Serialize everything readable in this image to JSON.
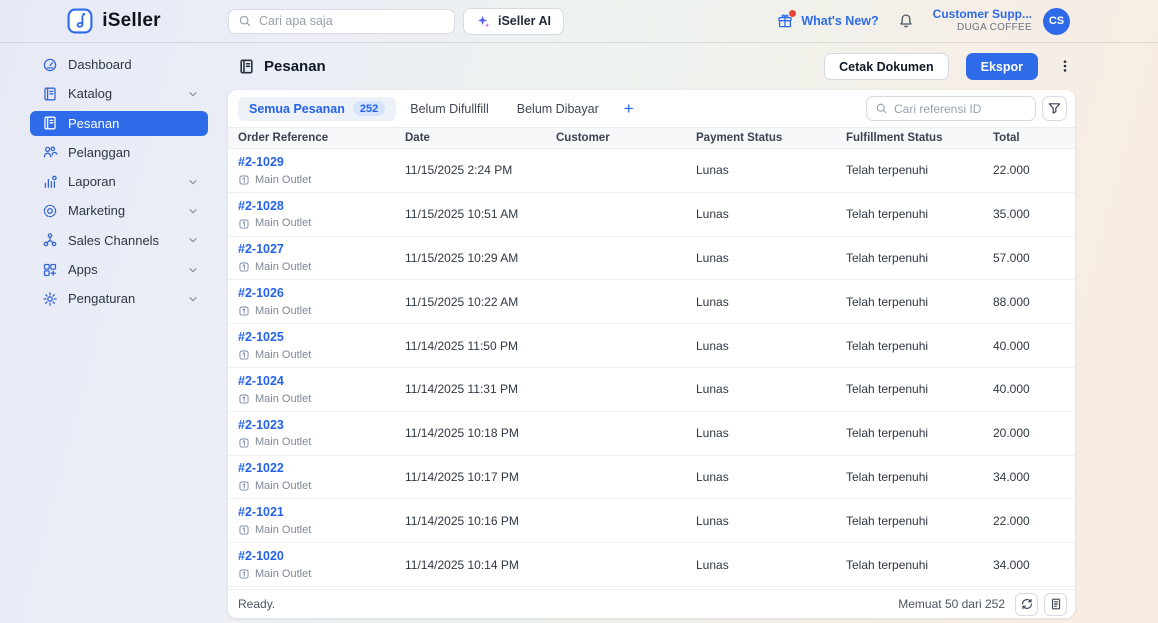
{
  "colors": {
    "primary": "#2e6be9",
    "link": "#2563eb"
  },
  "brand": {
    "name": "iSeller"
  },
  "topbar": {
    "search_placeholder": "Cari apa saja",
    "ai_button_label": "iSeller AI",
    "whats_new_label": "What's New?",
    "account_name": "Customer Supp...",
    "account_org": "DUGA COFFEE",
    "avatar_initials": "CS"
  },
  "sidebar": {
    "items": [
      {
        "label": "Dashboard",
        "icon": "dashboard-icon",
        "has_chevron": false,
        "active": false
      },
      {
        "label": "Katalog",
        "icon": "katalog-icon",
        "has_chevron": true,
        "active": false
      },
      {
        "label": "Pesanan",
        "icon": "pesanan-icon",
        "has_chevron": false,
        "active": true
      },
      {
        "label": "Pelanggan",
        "icon": "pelanggan-icon",
        "has_chevron": false,
        "active": false
      },
      {
        "label": "Laporan",
        "icon": "laporan-icon",
        "has_chevron": true,
        "active": false
      },
      {
        "label": "Marketing",
        "icon": "marketing-icon",
        "has_chevron": true,
        "active": false
      },
      {
        "label": "Sales Channels",
        "icon": "sales-channels-icon",
        "has_chevron": true,
        "active": false
      },
      {
        "label": "Apps",
        "icon": "apps-icon",
        "has_chevron": true,
        "active": false
      },
      {
        "label": "Pengaturan",
        "icon": "pengaturan-icon",
        "has_chevron": true,
        "active": false
      }
    ]
  },
  "page": {
    "title": "Pesanan",
    "print_button_label": "Cetak Dokumen",
    "export_button_label": "Ekspor",
    "tabs": [
      {
        "label": "Semua Pesanan",
        "badge": "252",
        "active": true
      },
      {
        "label": "Belum Difullfill",
        "active": false
      },
      {
        "label": "Belum Dibayar",
        "active": false
      }
    ],
    "add_tab_label": "+",
    "ref_search_placeholder": "Cari referensi ID"
  },
  "table": {
    "columns": [
      "Order Reference",
      "Date",
      "Customer",
      "Payment Status",
      "Fulfillment Status",
      "Total"
    ],
    "rows": [
      {
        "ref": "#2-1029",
        "outlet": "Main Outlet",
        "date": "11/15/2025 2:24 PM",
        "customer": "",
        "payment_status": "Lunas",
        "fulfillment_status": "Telah terpenuhi",
        "total": "22.000"
      },
      {
        "ref": "#2-1028",
        "outlet": "Main Outlet",
        "date": "11/15/2025 10:51 AM",
        "customer": "",
        "payment_status": "Lunas",
        "fulfillment_status": "Telah terpenuhi",
        "total": "35.000"
      },
      {
        "ref": "#2-1027",
        "outlet": "Main Outlet",
        "date": "11/15/2025 10:29 AM",
        "customer": "",
        "payment_status": "Lunas",
        "fulfillment_status": "Telah terpenuhi",
        "total": "57.000"
      },
      {
        "ref": "#2-1026",
        "outlet": "Main Outlet",
        "date": "11/15/2025 10:22 AM",
        "customer": "",
        "payment_status": "Lunas",
        "fulfillment_status": "Telah terpenuhi",
        "total": "88.000"
      },
      {
        "ref": "#2-1025",
        "outlet": "Main Outlet",
        "date": "11/14/2025 11:50 PM",
        "customer": "",
        "payment_status": "Lunas",
        "fulfillment_status": "Telah terpenuhi",
        "total": "40.000"
      },
      {
        "ref": "#2-1024",
        "outlet": "Main Outlet",
        "date": "11/14/2025 11:31 PM",
        "customer": "",
        "payment_status": "Lunas",
        "fulfillment_status": "Telah terpenuhi",
        "total": "40.000"
      },
      {
        "ref": "#2-1023",
        "outlet": "Main Outlet",
        "date": "11/14/2025 10:18 PM",
        "customer": "",
        "payment_status": "Lunas",
        "fulfillment_status": "Telah terpenuhi",
        "total": "20.000"
      },
      {
        "ref": "#2-1022",
        "outlet": "Main Outlet",
        "date": "11/14/2025 10:17 PM",
        "customer": "",
        "payment_status": "Lunas",
        "fulfillment_status": "Telah terpenuhi",
        "total": "34.000"
      },
      {
        "ref": "#2-1021",
        "outlet": "Main Outlet",
        "date": "11/14/2025 10:16 PM",
        "customer": "",
        "payment_status": "Lunas",
        "fulfillment_status": "Telah terpenuhi",
        "total": "22.000"
      },
      {
        "ref": "#2-1020",
        "outlet": "Main Outlet",
        "date": "11/14/2025 10:14 PM",
        "customer": "",
        "payment_status": "Lunas",
        "fulfillment_status": "Telah terpenuhi",
        "total": "34.000"
      }
    ]
  },
  "footer": {
    "status": "Ready.",
    "loaded_info": "Memuat 50 dari 252"
  }
}
